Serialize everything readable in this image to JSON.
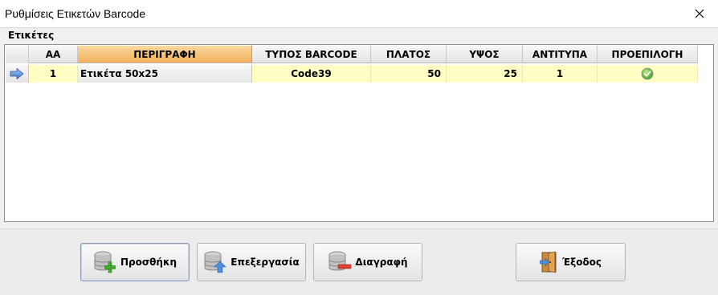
{
  "window": {
    "title": "Ρυθμίσεις Ετικετών Barcode"
  },
  "group": {
    "label": "Ετικέτες"
  },
  "grid": {
    "columns": [
      "ΑΑ",
      "ΠΕΡΙΓΡΑΦΗ",
      "ΤΥΠΟΣ BARCODE",
      "ΠΛΑΤΟΣ",
      "ΥΨΟΣ",
      "ΑΝΤΙΤΥΠΑ",
      "ΠΡΟΕΠΙΛΟΓΗ"
    ],
    "sorted_column": "ΠΕΡΙΓΡΑΦΗ",
    "rows": [
      {
        "aa": "1",
        "description": "Ετικέτα 50x25",
        "barcode_type": "Code39",
        "width": "50",
        "height": "25",
        "copies": "1",
        "default": true
      }
    ]
  },
  "buttons": {
    "add": "Προσθήκη",
    "edit": "Επεξεργασία",
    "delete": "Διαγραφή",
    "exit": "Έξοδος"
  },
  "colors": {
    "row_highlight": "#ffffc4",
    "sorted_header": "#f3b05c",
    "check_green": "#4caf2a"
  },
  "icons": {
    "row_indicator": "arrow-right-icon",
    "default_mark": "check-circle-icon",
    "add": "database-add-icon",
    "edit": "database-edit-icon",
    "delete": "database-delete-icon",
    "exit": "door-exit-icon"
  }
}
